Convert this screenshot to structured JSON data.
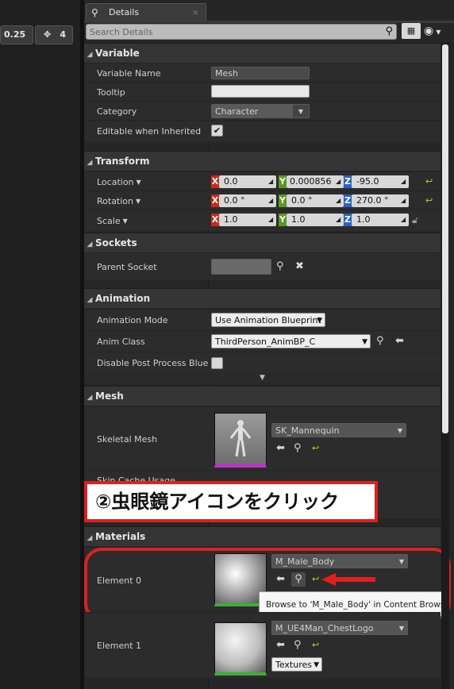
{
  "viewport": {
    "zoom_value": "0.25",
    "cam_speed": "4"
  },
  "details": {
    "tab_title": "Details",
    "search_placeholder": "Search Details"
  },
  "variable": {
    "header": "Variable",
    "name_label": "Variable Name",
    "name_value": "Mesh",
    "tooltip_label": "Tooltip",
    "tooltip_value": "",
    "category_label": "Category",
    "category_value": "Character",
    "editable_label": "Editable when Inherited",
    "editable_checked": true
  },
  "transform": {
    "header": "Transform",
    "location_label": "Location",
    "rotation_label": "Rotation",
    "scale_label": "Scale",
    "location": {
      "x": "0.0",
      "y": "0.000856",
      "z": "-95.0"
    },
    "rotation": {
      "x": "0.0 °",
      "y": "0.0 °",
      "z": "270.0 °"
    },
    "scale": {
      "x": "1.0",
      "y": "1.0",
      "z": "1.0"
    },
    "axis_colors": {
      "x": "#c92a1e",
      "y": "#5b9a1e",
      "z": "#2a61c4"
    }
  },
  "sockets": {
    "header": "Sockets",
    "parent_label": "Parent Socket",
    "parent_value": ""
  },
  "animation": {
    "header": "Animation",
    "mode_label": "Animation Mode",
    "mode_value": "Use Animation Blueprint",
    "class_label": "Anim Class",
    "class_value": "ThirdPerson_AnimBP_C",
    "disable_label": "Disable Post Process Blueprint",
    "disable_checked": false
  },
  "mesh": {
    "header": "Mesh",
    "skeletal_label": "Skeletal Mesh",
    "skeletal_value": "SK_Mannequin",
    "partial_row": "Skin Cache Usage"
  },
  "annotation": {
    "label": "②虫眼鏡アイコンをクリック"
  },
  "materials": {
    "header": "Materials",
    "element0_label": "Element 0",
    "element0_value": "M_Male_Body",
    "element1_label": "Element 1",
    "element1_value": "M_UE4Man_ChestLogo",
    "textures_label": "Textures"
  },
  "tooltip": {
    "text": "Browse to 'M_Male_Body' in Content Browser"
  },
  "colors": {
    "accent_red": "#e02020",
    "highlight_yellow": "#d6c125"
  }
}
